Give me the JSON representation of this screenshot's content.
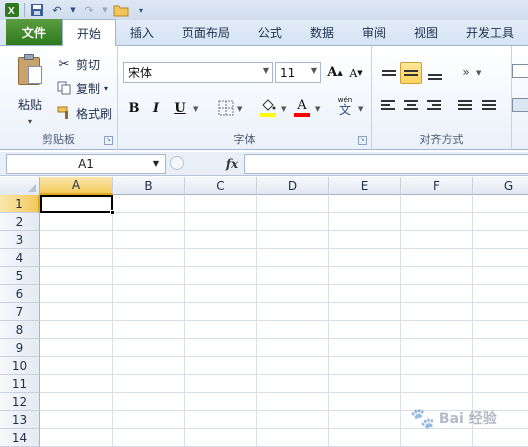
{
  "quick_access": {
    "icons": [
      "excel-logo-icon",
      "save-icon",
      "undo-icon",
      "redo-icon",
      "open-folder-icon",
      "customize-icon"
    ]
  },
  "tabs": [
    {
      "label": "文件"
    },
    {
      "label": "开始"
    },
    {
      "label": "插入"
    },
    {
      "label": "页面布局"
    },
    {
      "label": "公式"
    },
    {
      "label": "数据"
    },
    {
      "label": "审阅"
    },
    {
      "label": "视图"
    },
    {
      "label": "开发工具"
    }
  ],
  "ribbon": {
    "clipboard": {
      "group_label": "剪贴板",
      "paste": "粘贴",
      "cut": "剪切",
      "copy": "复制",
      "format_painter": "格式刷"
    },
    "font": {
      "group_label": "字体",
      "font_name": "宋体",
      "font_size": "11",
      "grow": "A",
      "shrink": "A",
      "bold": "B",
      "italic": "I",
      "underline": "U",
      "font_color_letter": "A",
      "phonetic": "wén"
    },
    "alignment": {
      "group_label": "对齐方式"
    }
  },
  "formula_bar": {
    "name_box": "A1",
    "fx": "fx",
    "value": ""
  },
  "sheet": {
    "columns": [
      "A",
      "B",
      "C",
      "D",
      "E",
      "F",
      "G"
    ],
    "rows": [
      "1",
      "2",
      "3",
      "4",
      "5",
      "6",
      "7",
      "8",
      "9",
      "10",
      "11",
      "12",
      "13",
      "14"
    ],
    "selected_cell": "A1"
  },
  "watermark": {
    "text": "Bai 经验"
  },
  "colors": {
    "file_tab": "#3f8a2a",
    "selection_header": "#f4c95c",
    "ribbon_border": "#9fb4d1"
  }
}
